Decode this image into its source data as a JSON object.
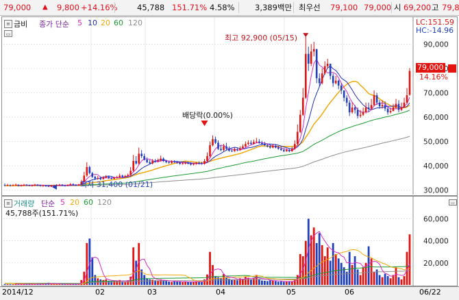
{
  "topbar": {
    "price": "79,000",
    "change_arrow": "▲",
    "change": "9,800",
    "change_pct": "+14.16%",
    "volume": "45,788",
    "volume_ratio": "151.71%",
    "turnover": "4.58%",
    "amount": "3,389백만",
    "best_bid_label": "최우선",
    "best_bid": "79,100",
    "best_ask": "79,000",
    "open_label": "시",
    "open": "69,200",
    "high_label": "고",
    "high_partial": "79,8"
  },
  "price_panel": {
    "title_prefix": "금비",
    "legend_kind": "종가 단순",
    "ma_periods": [
      "5",
      "10",
      "20",
      "60",
      "120"
    ],
    "lc": "LC:151.59",
    "hc": "HC:-14.96",
    "current_price": "79,000",
    "current_pct": "14.16%",
    "annotation_high": "최고 92,900 (05/15)",
    "annotation_low": "최저 31,400 (01/21)",
    "annotation_div": "배당락(0.00%)"
  },
  "volume_panel": {
    "legend_kind": "거래량",
    "legend_ma": "단순",
    "ma_periods": [
      "5",
      "20",
      "60",
      "120"
    ],
    "current": "45,788주(151.71%)"
  },
  "x_axis": {
    "labels": [
      "2014/12",
      "02",
      "03",
      "04",
      "05",
      "06",
      "06/22"
    ]
  },
  "colors": {
    "up": "#e3130f",
    "down": "#1f3fbf",
    "ma5": "#d429c8",
    "ma10": "#1f2fb8",
    "ma20": "#f0a808",
    "ma60": "#1a9a30",
    "ma120": "#8c8c8c"
  },
  "chart_data": [
    {
      "type": "candlestick",
      "title": "금비",
      "y_ticks": [
        "90,000",
        "80,000",
        "70,000",
        "60,000",
        "50,000",
        "40,000",
        "30,000"
      ],
      "ylim": [
        28500,
        95500
      ],
      "x_categories": [
        "2014/12",
        "02",
        "03",
        "04",
        "05",
        "06",
        "06/22"
      ],
      "series": [
        {
          "name": "5",
          "kind": "ma"
        },
        {
          "name": "10",
          "kind": "ma"
        },
        {
          "name": "20",
          "kind": "ma"
        },
        {
          "name": "60",
          "kind": "ma"
        },
        {
          "name": "120",
          "kind": "ma"
        }
      ],
      "close": [
        32000,
        32200,
        31900,
        32100,
        32300,
        31800,
        32000,
        32200,
        32100,
        31900,
        32000,
        32300,
        32100,
        31800,
        32000,
        31600,
        31400,
        31800,
        32000,
        32100,
        32300,
        32000,
        31800,
        32100,
        32500,
        32200,
        32000,
        32300,
        33500,
        36000,
        39500,
        37000,
        35500,
        34800,
        35000,
        34500,
        35200,
        35600,
        35000,
        34700,
        35100,
        35400,
        36000,
        35500,
        35800,
        36200,
        38000,
        42000,
        41000,
        45000,
        44000,
        42500,
        41500,
        41000,
        42000,
        41800,
        42200,
        43000,
        42000,
        41500,
        41200,
        41800,
        41500,
        41200,
        40800,
        41000,
        41300,
        41000,
        40500,
        40800,
        41200,
        41000,
        40800,
        42000,
        44000,
        48500,
        51000,
        49500,
        47000,
        46500,
        48000,
        47000,
        46200,
        46000,
        46800,
        46500,
        47200,
        48000,
        49000,
        49500,
        49000,
        49800,
        50000,
        49500,
        49000,
        48500,
        48000,
        47500,
        48200,
        47500,
        47000,
        46500,
        46000,
        46500,
        46000,
        47000,
        49000,
        54000,
        61000,
        68000,
        86000,
        82000,
        87000,
        88000,
        76000,
        74000,
        78000,
        81000,
        82000,
        77000,
        74000,
        75000,
        73000,
        71000,
        68000,
        66000,
        62000,
        64000,
        63000,
        60500,
        61000,
        62000,
        64000,
        63500,
        65000,
        69000,
        66000,
        64500,
        65000,
        63500,
        62000,
        62500,
        64000,
        65500,
        63000,
        64000,
        66000,
        69000,
        79000
      ],
      "open": [
        32200,
        32000,
        32100,
        31900,
        32100,
        32200,
        31800,
        32000,
        32300,
        32100,
        31900,
        32000,
        32300,
        32100,
        31800,
        32000,
        31800,
        31400,
        31900,
        32000,
        32100,
        32300,
        32000,
        31800,
        32100,
        32500,
        32200,
        32000,
        32400,
        33500,
        36000,
        39500,
        37000,
        35500,
        34800,
        35000,
        34600,
        35200,
        35600,
        35000,
        34700,
        35100,
        35400,
        36000,
        35500,
        35800,
        36200,
        38000,
        42000,
        41000,
        45000,
        44000,
        42500,
        41500,
        41000,
        42000,
        41800,
        42200,
        43000,
        42000,
        41500,
        41200,
        41800,
        41500,
        41200,
        40800,
        41000,
        41300,
        41000,
        40500,
        40800,
        41200,
        41000,
        40800,
        42000,
        44000,
        48500,
        51000,
        49500,
        47000,
        46500,
        48000,
        47000,
        46200,
        46000,
        46800,
        46500,
        47200,
        48000,
        49000,
        49500,
        49000,
        49800,
        50000,
        49500,
        49000,
        48500,
        48000,
        47500,
        48200,
        47500,
        47000,
        46500,
        46000,
        46500,
        46000,
        47000,
        49000,
        54000,
        61000,
        68000,
        86000,
        82000,
        87000,
        88000,
        76000,
        74000,
        78000,
        81000,
        82000,
        77000,
        74000,
        75000,
        73000,
        71000,
        68000,
        66000,
        62000,
        64000,
        63000,
        60500,
        61000,
        62000,
        64000,
        63500,
        65000,
        69000,
        66000,
        64500,
        65000,
        63500,
        62000,
        62500,
        64000,
        65500,
        63000,
        64000,
        66000,
        69200
      ],
      "high": [
        32800,
        32600,
        32400,
        32500,
        32700,
        32400,
        32300,
        32600,
        32500,
        32300,
        32300,
        32600,
        32500,
        32300,
        32200,
        32100,
        32100,
        32200,
        32300,
        32400,
        32600,
        32500,
        32200,
        32400,
        32900,
        32800,
        32500,
        32600,
        34200,
        37500,
        41500,
        40000,
        37500,
        36000,
        35800,
        35600,
        35800,
        36200,
        36000,
        35400,
        35500,
        35900,
        36800,
        36400,
        36300,
        36800,
        39500,
        44500,
        44000,
        47500,
        46500,
        45000,
        43500,
        42500,
        42800,
        42800,
        43000,
        44200,
        43500,
        42500,
        42000,
        42300,
        42300,
        42000,
        41600,
        41500,
        41800,
        41800,
        41500,
        41200,
        41600,
        41800,
        41600,
        42800,
        45500,
        50000,
        52500,
        52000,
        50500,
        48500,
        49000,
        49500,
        48000,
        47000,
        47500,
        47500,
        48000,
        48800,
        50000,
        50500,
        50500,
        50800,
        51500,
        51000,
        50300,
        49800,
        49200,
        48800,
        49000,
        49000,
        48200,
        47800,
        47200,
        47200,
        47000,
        47800,
        50500,
        57000,
        63000,
        72000,
        92900,
        89000,
        90000,
        91000,
        85000,
        78000,
        80000,
        83000,
        84000,
        82000,
        78000,
        77000,
        75500,
        74000,
        71000,
        69000,
        67000,
        66000,
        65000,
        64000,
        63000,
        64000,
        66000,
        66000,
        67500,
        71000,
        70000,
        67000,
        67000,
        66500,
        64500,
        64000,
        65500,
        67500,
        67000,
        66000,
        68000,
        72000,
        80200
      ],
      "low": [
        31500,
        31600,
        31500,
        31600,
        31800,
        31500,
        31500,
        31700,
        31700,
        31600,
        31500,
        31700,
        31700,
        31500,
        31400,
        31400,
        31400,
        31300,
        31500,
        31700,
        31800,
        31700,
        31500,
        31600,
        31900,
        31900,
        31700,
        31800,
        32200,
        33200,
        35500,
        36500,
        35000,
        34200,
        34300,
        34100,
        34300,
        35000,
        34600,
        34400,
        34500,
        34800,
        35100,
        35100,
        35300,
        35600,
        35800,
        37500,
        40500,
        40500,
        43200,
        42200,
        41100,
        40700,
        40600,
        41300,
        41400,
        41800,
        41600,
        41100,
        40900,
        40900,
        41200,
        40900,
        40500,
        40500,
        40600,
        40600,
        40200,
        40200,
        40500,
        40600,
        40500,
        40500,
        41500,
        43500,
        48000,
        49000,
        46500,
        46000,
        46000,
        46500,
        45800,
        45700,
        45800,
        46000,
        46200,
        46900,
        47600,
        48500,
        48700,
        48800,
        49300,
        49100,
        48600,
        48100,
        47600,
        47100,
        47200,
        47200,
        46600,
        46200,
        45700,
        45800,
        45600,
        45800,
        46700,
        48500,
        53500,
        60500,
        67500,
        79000,
        81000,
        85000,
        74000,
        72500,
        73500,
        77500,
        80000,
        75500,
        72500,
        73500,
        71500,
        69500,
        66500,
        64500,
        60500,
        61500,
        61500,
        59500,
        59800,
        60500,
        61500,
        62000,
        63000,
        64500,
        65000,
        63500,
        63500,
        62500,
        61000,
        61500,
        62500,
        63500,
        62000,
        62500,
        64500,
        65500,
        68800
      ],
      "ma_hint": "moving averages computed in script"
    },
    {
      "type": "bar",
      "title": "거래량",
      "y_ticks": [
        "60,000",
        "40,000",
        "20,000"
      ],
      "ylim": [
        0,
        72000
      ],
      "series": [
        {
          "name": "거래량",
          "kind": "volume"
        }
      ],
      "values": [
        800,
        700,
        600,
        650,
        900,
        500,
        700,
        600,
        800,
        700,
        500,
        600,
        700,
        900,
        600,
        1500,
        2000,
        800,
        700,
        900,
        600,
        700,
        800,
        500,
        600,
        900,
        700,
        800,
        4500,
        12000,
        38000,
        42000,
        25000,
        9000,
        6000,
        5000,
        4500,
        5000,
        3500,
        3200,
        3800,
        3500,
        4500,
        3000,
        2800,
        4200,
        7500,
        34000,
        22000,
        38000,
        14000,
        9000,
        6000,
        5000,
        4800,
        4200,
        3800,
        5000,
        4000,
        3500,
        3000,
        2800,
        3500,
        3000,
        2800,
        2500,
        3000,
        2800,
        2500,
        3000,
        3200,
        2800,
        2500,
        5000,
        9500,
        30000,
        18000,
        8000,
        7000,
        6500,
        10000,
        7000,
        5500,
        4500,
        5000,
        4200,
        6000,
        5500,
        7500,
        6500,
        5000,
        6000,
        9000,
        5000,
        4000,
        3800,
        3500,
        4500,
        4000,
        3500,
        3000,
        3200,
        2800,
        3000,
        3500,
        3000,
        5000,
        9000,
        28000,
        26000,
        40000,
        60000,
        45000,
        52000,
        38000,
        47000,
        36000,
        26000,
        34000,
        22000,
        38000,
        28000,
        24000,
        20000,
        16000,
        12000,
        30000,
        18000,
        26000,
        14000,
        9000,
        16000,
        20000,
        35000,
        24000,
        12000,
        14000,
        9000,
        7000,
        10000,
        8000,
        6000,
        9000,
        16000,
        7000,
        5000,
        8000,
        30000,
        45788
      ]
    }
  ]
}
